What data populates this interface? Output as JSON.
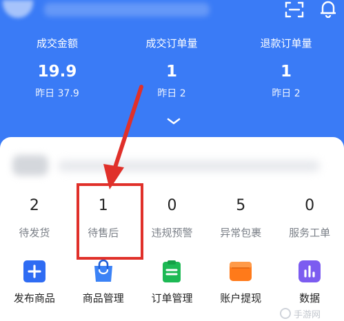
{
  "header": {
    "stats": [
      {
        "label": "成交金额",
        "value": "19.9",
        "sub": "昨日 37.9"
      },
      {
        "label": "成交订单量",
        "value": "1",
        "sub": "昨日 2"
      },
      {
        "label": "退款订单量",
        "value": "1",
        "sub": "昨日 2"
      }
    ]
  },
  "metrics": [
    {
      "value": "2",
      "label": "待发货"
    },
    {
      "value": "1",
      "label": "待售后"
    },
    {
      "value": "0",
      "label": "违规预警"
    },
    {
      "value": "5",
      "label": "异常包裹"
    },
    {
      "value": "0",
      "label": "服务工单"
    }
  ],
  "tools": [
    {
      "label": "发布商品",
      "icon": "plus-icon",
      "color": "#2f6cf3"
    },
    {
      "label": "商品管理",
      "icon": "shopping-bag-icon",
      "color": "#3b82f6"
    },
    {
      "label": "订单管理",
      "icon": "clipboard-icon",
      "color": "#1db954"
    },
    {
      "label": "账户提现",
      "icon": "wallet-icon",
      "color": "#ff7a1a"
    },
    {
      "label": "数据",
      "icon": "bar-chart-icon",
      "color": "#7c5cf0"
    }
  ],
  "colors": {
    "header_bg": "#3a7bf6",
    "annotation": "#e0302a"
  },
  "watermark": {
    "text": "手游网"
  }
}
